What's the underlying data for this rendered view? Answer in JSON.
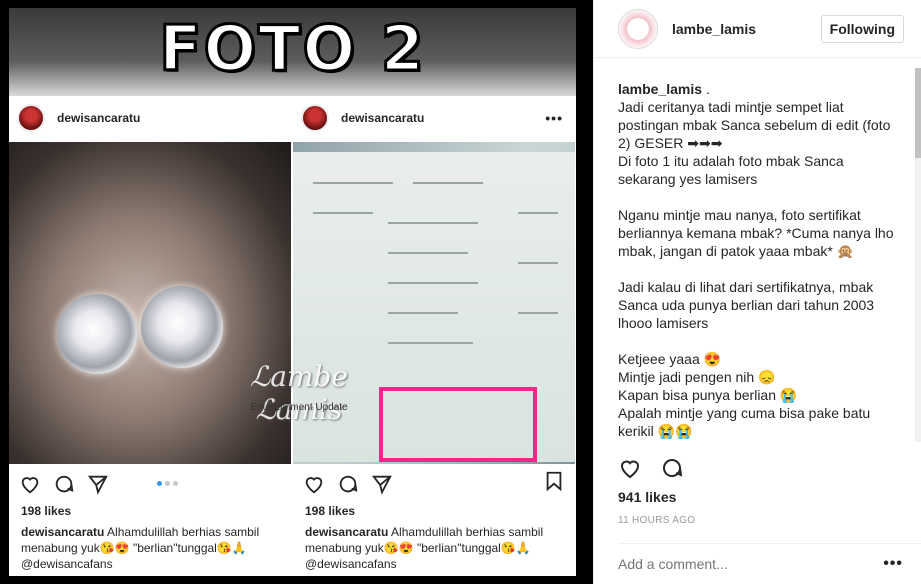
{
  "image": {
    "banner_title": "FOTO 2",
    "left_panel": {
      "username": "dewisancaratu",
      "likes": "198 likes",
      "caption_user": "dewisancaratu",
      "caption_text": " Alhamdulillah berhias sambil menabung yuk😘😍 \"berlian\"tunggal😘🙏 @dewisancafans"
    },
    "right_panel": {
      "username": "dewisancaratu",
      "more_icon": "more-dots-icon",
      "likes": "198 likes",
      "caption_user": "dewisancaratu",
      "caption_text": " Alhamdulillah berhias sambil menabung yuk😘😍 \"berlian\"tunggal😘🙏 @dewisancafans"
    },
    "watermark": "ℒambe ℒamis",
    "watermark_sub": "Entertainment Update",
    "highlight_color": "#f0268a"
  },
  "sidebar": {
    "username": "lambe_lamis",
    "follow_label": "Following",
    "comment_user": "lambe_lamis",
    "comment_text": " .\nJadi ceritanya tadi mintje sempet liat postingan mbak Sanca sebelum di edit (foto 2) GESER ➡➡➡\nDi foto 1 itu adalah foto mbak Sanca sekarang yes lamisers\n\nNganu mintje mau nanya, foto sertifikat berliannya kemana mbak? *Cuma nanya lho mbak, jangan di patok yaaa mbak* 🙊\n\nJadi kalau di lihat dari sertifikatnya, mbak Sanca uda punya berlian dari tahun 2003 lhooo lamisers\n\nKetjeee yaaa 😍\nMintje jadi pengen nih 😞\nKapan bisa punya berlian 😭\nApalah mintje yang cuma bisa pake batu kerikil 😭😭",
    "likes": "941 likes",
    "time": "11 HOURS AGO",
    "comment_placeholder": "Add a comment...",
    "more_icon": "more-dots-icon"
  }
}
